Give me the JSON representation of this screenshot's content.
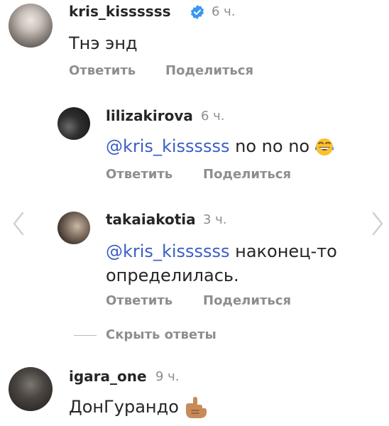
{
  "comments": [
    {
      "username": "kris_kissssss",
      "time": "6 ч.",
      "text": "Тнэ энд",
      "reply_label": "Ответить",
      "share_label": "Поделиться"
    },
    {
      "username": "lilizakirova",
      "time": "6 ч.",
      "mention": "@kris_kissssss",
      "text": " no no no",
      "reply_label": "Ответить",
      "share_label": "Поделиться"
    },
    {
      "username": "takaiakotia",
      "time": "3 ч.",
      "mention": "@kris_kissssss",
      "text": " наконец-то",
      "text_line2": "определилась.",
      "reply_label": "Ответить",
      "share_label": "Поделиться"
    },
    {
      "username": "igara_one",
      "time": "9 ч.",
      "text": "ДонГурандо"
    }
  ],
  "hide_replies_label": "Скрыть ответы",
  "icons": {
    "verified": "verified-badge-icon",
    "laugh_emoji": "tears-of-joy-emoji",
    "call_me_emoji": "call-me-hand-emoji",
    "nav_prev": "chevron-left-icon",
    "nav_next": "chevron-right-icon"
  },
  "colors": {
    "mention": "#3b5ec6",
    "secondary_text": "#8e8e8e",
    "verified": "#3897f0"
  }
}
